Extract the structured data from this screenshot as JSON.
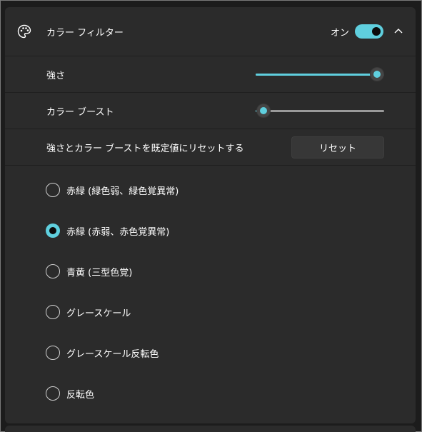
{
  "header": {
    "title": "カラー フィルター",
    "toggle_label": "オン",
    "toggle_on": true,
    "icon": "palette-icon",
    "expand_icon": "chevron-up-icon"
  },
  "settings": {
    "intensity": {
      "label": "強さ",
      "value": 1.0
    },
    "boost": {
      "label": "カラー ブースト",
      "value": 0.06
    },
    "reset": {
      "label": "強さとカラー ブーストを既定値にリセットする",
      "button_label": "リセット"
    }
  },
  "filters": {
    "options": [
      {
        "label": "赤緑 (緑色弱、緑色覚異常)",
        "selected": false
      },
      {
        "label": "赤緑 (赤弱、赤色覚異常)",
        "selected": true
      },
      {
        "label": "青黄 (三型色覚)",
        "selected": false
      },
      {
        "label": "グレースケール",
        "selected": false
      },
      {
        "label": "グレースケール反転色",
        "selected": false
      },
      {
        "label": "反転色",
        "selected": false
      }
    ]
  },
  "colors": {
    "accent": "#5fcfde",
    "panel": "#2b2b2b",
    "background": "#202020"
  }
}
